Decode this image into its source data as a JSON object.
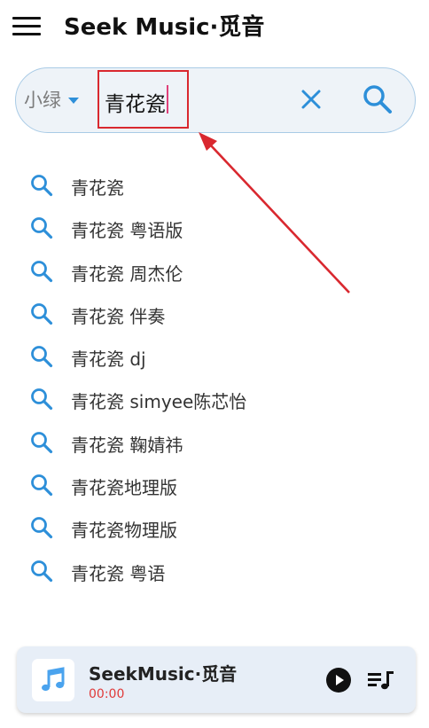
{
  "header": {
    "title": "Seek Music·觅音",
    "menu_icon": "hamburger-menu-icon"
  },
  "search": {
    "source_selected": "小绿",
    "query": "青花瓷",
    "clear_icon": "close-icon",
    "search_icon": "search-icon",
    "accent_color": "#2d8fd9"
  },
  "suggestions": [
    {
      "text": "青花瓷"
    },
    {
      "text": "青花瓷 粤语版"
    },
    {
      "text": "青花瓷 周杰伦"
    },
    {
      "text": "青花瓷 伴奏"
    },
    {
      "text": "青花瓷 dj"
    },
    {
      "text": "青花瓷 simyee陈芯怡"
    },
    {
      "text": "青花瓷 鞠婧祎"
    },
    {
      "text": "青花瓷地理版"
    },
    {
      "text": "青花瓷物理版"
    },
    {
      "text": "青花瓷 粤语"
    }
  ],
  "player": {
    "title": "SeekMusic·觅音",
    "time": "00:00",
    "cover_icon": "music-note-icon",
    "play_icon": "play-icon",
    "queue_icon": "playlist-icon"
  },
  "annotation": {
    "color": "#d9282f"
  }
}
